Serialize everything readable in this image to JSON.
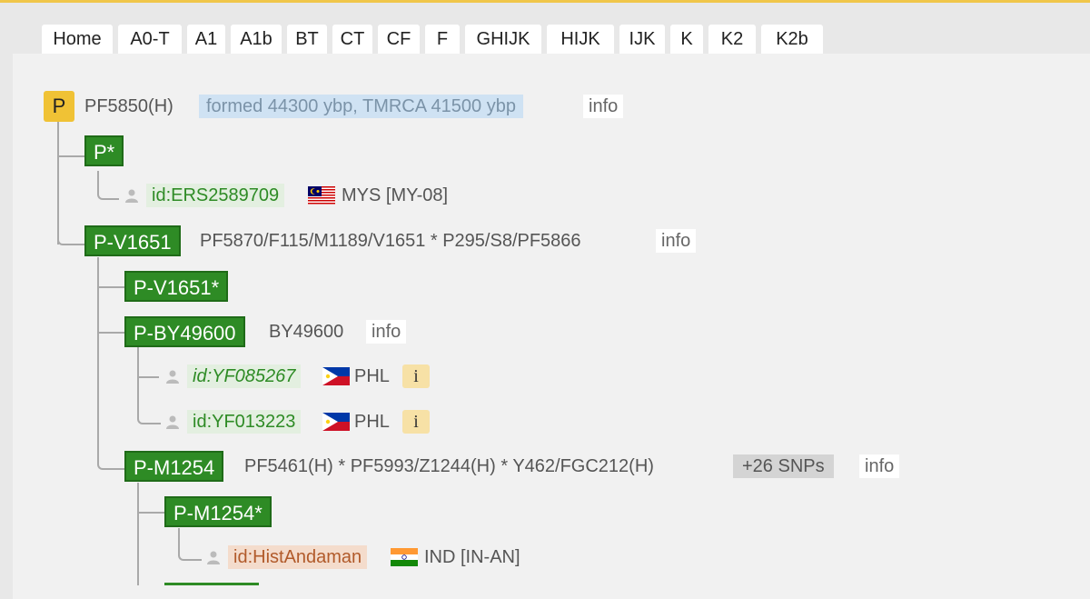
{
  "nav_tabs": [
    "Home",
    "A0-T",
    "A1",
    "A1b",
    "BT",
    "CT",
    "CF",
    "F",
    "GHIJK",
    "HIJK",
    "IJK",
    "K",
    "K2",
    "K2b"
  ],
  "tree": {
    "root": {
      "label": "P",
      "snps": "PF5850(H)",
      "formed": "formed 44300 ybp, TMRCA 41500 ybp",
      "info": "info"
    },
    "p_star": {
      "label": "P*"
    },
    "sample_ers": {
      "id": "id:ERS2589709",
      "country": "MYS [MY-08]",
      "flag": "malaysia-flag"
    },
    "p_v1651": {
      "label": "P-V1651",
      "snps": "PF5870/F115/M1189/V1651 * P295/S8/PF5866",
      "info": "info"
    },
    "p_v1651_star": {
      "label": "P-V1651*"
    },
    "p_by49600": {
      "label": "P-BY49600",
      "snps": "BY49600",
      "info": "info"
    },
    "sample_yf085267": {
      "id": "id:YF085267",
      "country": "PHL",
      "info": "i",
      "flag": "philippines-flag"
    },
    "sample_yf013223": {
      "id": "id:YF013223",
      "country": "PHL",
      "info": "i",
      "flag": "philippines-flag"
    },
    "p_m1254": {
      "label": "P-M1254",
      "snps": "PF5461(H) * PF5993/Z1244(H) * Y462/FGC212(H)",
      "more_snps": "+26 SNPs",
      "info": "info"
    },
    "p_m1254_star": {
      "label": "P-M1254*"
    },
    "sample_hist": {
      "id": "id:HistAndaman",
      "country": "IND [IN-AN]",
      "flag": "india-flag"
    }
  },
  "colors": {
    "accent_bar": "#f0c64a",
    "root_badge": "#f0c235",
    "node_green": "#2e8b25",
    "formed_bg": "#cfe2f3",
    "hist_bg": "#f4dccc"
  }
}
